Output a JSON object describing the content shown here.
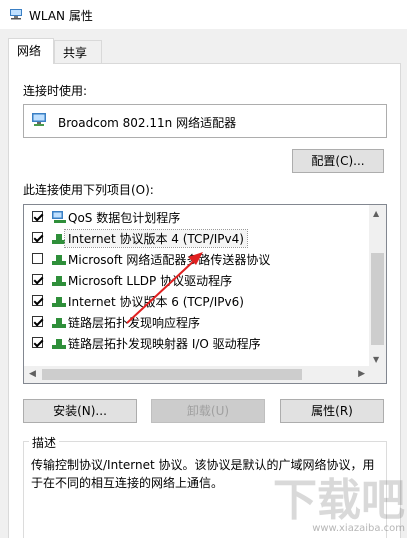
{
  "window": {
    "title": "WLAN 属性"
  },
  "tabs": [
    {
      "label": "网络",
      "active": true
    },
    {
      "label": "共享",
      "active": false
    }
  ],
  "connect_using": {
    "label": "连接时使用:",
    "adapter_name": "Broadcom 802.11n 网络适配器"
  },
  "buttons": {
    "configure": "配置(C)...",
    "install": "安装(N)...",
    "uninstall": "卸载(U)",
    "properties": "属性(R)"
  },
  "items_label": "此连接使用下列项目(O):",
  "items": [
    {
      "label": "QoS 数据包计划程序",
      "checked": true,
      "icon": "qos-icon"
    },
    {
      "label": "Internet 协议版本 4 (TCP/IPv4)",
      "checked": true,
      "icon": "protocol-icon"
    },
    {
      "label": "Microsoft 网络适配器多路传送器协议",
      "checked": false,
      "icon": "protocol-icon"
    },
    {
      "label": "Microsoft LLDP 协议驱动程序",
      "checked": true,
      "icon": "protocol-icon"
    },
    {
      "label": "Internet 协议版本 6 (TCP/IPv6)",
      "checked": true,
      "icon": "protocol-icon"
    },
    {
      "label": "链路层拓扑发现响应程序",
      "checked": true,
      "icon": "protocol-icon"
    },
    {
      "label": "链路层拓扑发现映射器 I/O 驱动程序",
      "checked": true,
      "icon": "protocol-icon"
    }
  ],
  "description": {
    "legend": "描述",
    "text": "传输控制协议/Internet 协议。该协议是默认的广域网络协议，用于在不同的相互连接的网络上通信。"
  },
  "watermark": {
    "logo": "下载吧",
    "url": "www.xiazaiba.com"
  },
  "colors": {
    "arrow": "#e02020",
    "protocol_icon": "#2f8f3a",
    "adapter_icon": "#3a7fc4"
  }
}
